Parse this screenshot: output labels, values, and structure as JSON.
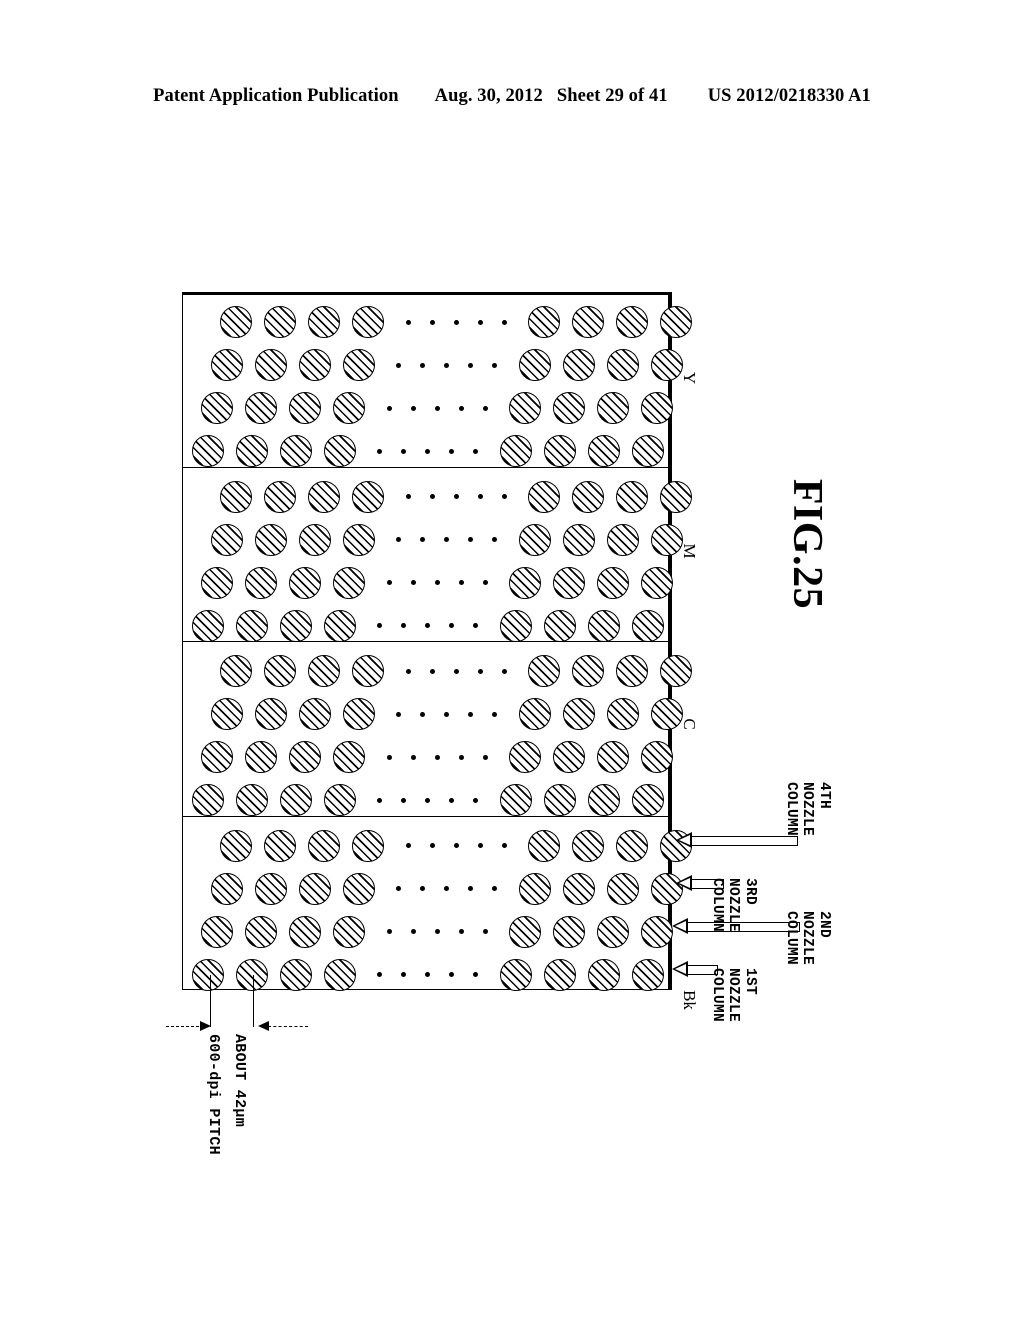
{
  "header": {
    "publication": "Patent Application Publication",
    "date": "Aug. 30, 2012",
    "sheet": "Sheet 29 of 41",
    "patent_number": "US 2012/0218330 A1"
  },
  "figure": {
    "title": "FIG.25",
    "color_groups": [
      {
        "id": "Y",
        "label": "Y"
      },
      {
        "id": "M",
        "label": "M"
      },
      {
        "id": "C",
        "label": "C"
      },
      {
        "id": "Bk",
        "label": "Bk"
      }
    ],
    "nozzle_columns": [
      {
        "index": 1,
        "label_lines": [
          "1ST",
          "NOZZLE",
          "COLUMN"
        ]
      },
      {
        "index": 2,
        "label_lines": [
          "2ND",
          "NOZZLE",
          "COLUMN"
        ]
      },
      {
        "index": 3,
        "label_lines": [
          "3RD",
          "NOZZLE",
          "COLUMN"
        ]
      },
      {
        "index": 4,
        "label_lines": [
          "4TH",
          "NOZZLE",
          "COLUMN"
        ]
      }
    ],
    "dimension": {
      "line1": "600-dpi PITCH",
      "line2": "ABOUT 42μm"
    },
    "layout": {
      "rows_per_group": 4,
      "circles_left_of_gap": 4,
      "circles_right_of_gap": 4,
      "ellipsis_dots": 5
    }
  }
}
